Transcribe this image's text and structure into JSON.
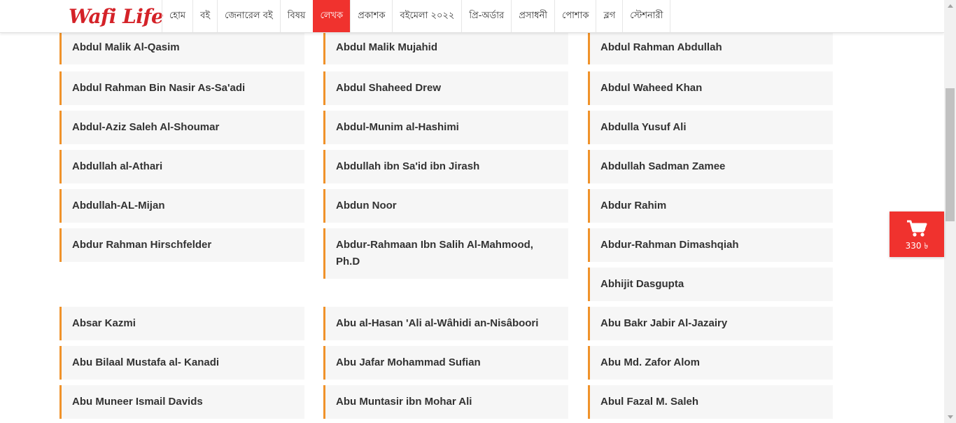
{
  "header": {
    "logo": "Wafi Life",
    "nav": [
      {
        "label": "হোম",
        "name": "nav-item-home",
        "active": false
      },
      {
        "label": "বই",
        "name": "nav-item-books",
        "active": false
      },
      {
        "label": "জেনারেল বই",
        "name": "nav-item-general-books",
        "active": false
      },
      {
        "label": "বিষয়",
        "name": "nav-item-subjects",
        "active": false
      },
      {
        "label": "লেখক",
        "name": "nav-item-authors",
        "active": true
      },
      {
        "label": "প্রকাশক",
        "name": "nav-item-publishers",
        "active": false
      },
      {
        "label": "বইমেলা ২০২২",
        "name": "nav-item-book-fair-2022",
        "active": false
      },
      {
        "label": "প্রি-অর্ডার",
        "name": "nav-item-pre-order",
        "active": false
      },
      {
        "label": "প্রসাধনী",
        "name": "nav-item-cosmetics",
        "active": false
      },
      {
        "label": "পোশাক",
        "name": "nav-item-clothing",
        "active": false
      },
      {
        "label": "ব্লগ",
        "name": "nav-item-blog",
        "active": false
      },
      {
        "label": "স্টেশনারী",
        "name": "nav-item-stationery",
        "active": false
      }
    ]
  },
  "authors": [
    {
      "name": "Abdul Malik Al-Qasim",
      "col": 0,
      "row": 0
    },
    {
      "name": "Abdul Malik Mujahid",
      "col": 1,
      "row": 0
    },
    {
      "name": "Abdul Rahman Abdullah",
      "col": 2,
      "row": 0
    },
    {
      "name": "Abdul Rahman Bin Nasir As-Sa'adi",
      "col": 0,
      "row": 1
    },
    {
      "name": "Abdul Shaheed Drew",
      "col": 1,
      "row": 1
    },
    {
      "name": "Abdul Waheed Khan",
      "col": 2,
      "row": 1
    },
    {
      "name": "Abdul-Aziz Saleh Al-Shoumar",
      "col": 0,
      "row": 2
    },
    {
      "name": "Abdul-Munim al-Hashimi",
      "col": 1,
      "row": 2
    },
    {
      "name": "Abdulla Yusuf Ali",
      "col": 2,
      "row": 2
    },
    {
      "name": "Abdullah al-Athari",
      "col": 0,
      "row": 3
    },
    {
      "name": "Abdullah ibn Sa'id ibn Jirash",
      "col": 1,
      "row": 3
    },
    {
      "name": "Abdullah Sadman Zamee",
      "col": 2,
      "row": 3
    },
    {
      "name": "Abdullah-AL-Mijan",
      "col": 0,
      "row": 4
    },
    {
      "name": "Abdun Noor",
      "col": 1,
      "row": 4
    },
    {
      "name": "Abdur Rahim",
      "col": 2,
      "row": 4
    },
    {
      "name": "Abdur Rahman Hirschfelder",
      "col": 0,
      "row": 5
    },
    {
      "name": "Abdur-Rahmaan Ibn Salih Al-Mahmood, Ph.D",
      "col": 1,
      "row": 5
    },
    {
      "name": "Abdur-Rahman Dimashqiah",
      "col": 2,
      "row": 5
    },
    {
      "name": "Abhijit Dasgupta",
      "col": 2,
      "row": 6
    },
    {
      "name": "Absar Kazmi",
      "col": 0,
      "row": 7
    },
    {
      "name": "Abu al-Hasan 'Ali al-Wâhidi an-Nisâboori",
      "col": 1,
      "row": 7
    },
    {
      "name": "Abu Bakr Jabir Al-Jazairy",
      "col": 2,
      "row": 7
    },
    {
      "name": "Abu Bilaal Mustafa al- Kanadi",
      "col": 0,
      "row": 8
    },
    {
      "name": "Abu Jafar Mohammad Sufian",
      "col": 1,
      "row": 8
    },
    {
      "name": "Abu Md. Zafor Alom",
      "col": 2,
      "row": 8
    },
    {
      "name": "Abu Muneer Ismail Davids",
      "col": 0,
      "row": 9
    },
    {
      "name": "Abu Muntasir ibn Mohar Ali",
      "col": 1,
      "row": 9
    },
    {
      "name": "Abul Fazal M. Saleh",
      "col": 2,
      "row": 9
    }
  ],
  "cart": {
    "icon": "shopping-cart-icon",
    "total": "330 ৳"
  },
  "colors": {
    "brand_red": "#f0322e",
    "card_accent": "#f0922a",
    "card_bg": "#f6f6f6"
  }
}
